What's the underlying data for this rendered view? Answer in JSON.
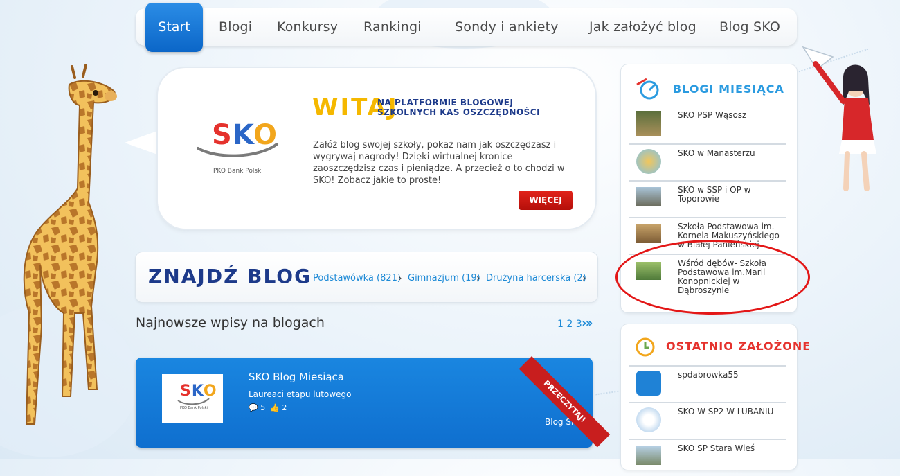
{
  "nav": {
    "items": [
      "Start",
      "Blogi",
      "Konkursy",
      "Rankingi",
      "Sondy i ankiety",
      "Jak założyć blog",
      "Blog SKO"
    ]
  },
  "welcome": {
    "logo_text": "SKO",
    "logo_caption": "PKO Bank Polski",
    "title": "WITAJ",
    "subtitle_line1": "NA PLATFORMIE BLOGOWEJ",
    "subtitle_line2": "SZKOLNYCH KAS OSZCZĘDNOŚCI",
    "text": "Załóż blog swojej szkoły, pokaż nam jak oszczędzasz i wygrywaj nagrody! Dzięki wirtualnej kronice zaoszczędzisz czas i pieniądze. A przecież o to chodzi w SKO! Zobacz jakie to proste!",
    "more_button": "WIĘCEJ"
  },
  "find_blog": {
    "title": "ZNAJDŹ BLOG",
    "links": [
      "Podstawówka (821)",
      "Gimnazjum (19)",
      "Drużyna harcerska (2)"
    ]
  },
  "latest": {
    "title": "Najnowsze wpisy na blogach",
    "pages": "1 2 3",
    "post": {
      "title": "SKO Blog Miesiąca",
      "subtitle": "Laureaci etapu lutowego",
      "comments": "5",
      "likes": "2",
      "link": "Blog SKO",
      "ribbon": "PRZECZYTAJ!"
    }
  },
  "blogs_of_month": {
    "title": "BLOGI MIESIĄCA",
    "items": [
      "SKO PSP Wąsosz",
      "SKO w Manasterzu",
      "SKO w SSP i OP w Toporowie",
      "Szkoła Podstawowa im. Kornela Makuszyńskiego w Białej Pańieńskiej",
      "Wśród dębów- Szkoła Podstawowa im.Marii Konopnickiej w Dąbroszynie"
    ]
  },
  "recently_added": {
    "title": "OSTATNIO ZAŁOŻONE",
    "items": [
      "spdabrowka55",
      "SKO W SP2 W LUBANIU",
      "SKO SP Stara Wieś"
    ]
  },
  "colors": {
    "accent_blue": "#0f6fcf",
    "brand_red": "#c81e1e",
    "title_navy": "#1d3a8a",
    "title_yellow": "#f5b800",
    "annotation_red": "#e31717"
  }
}
